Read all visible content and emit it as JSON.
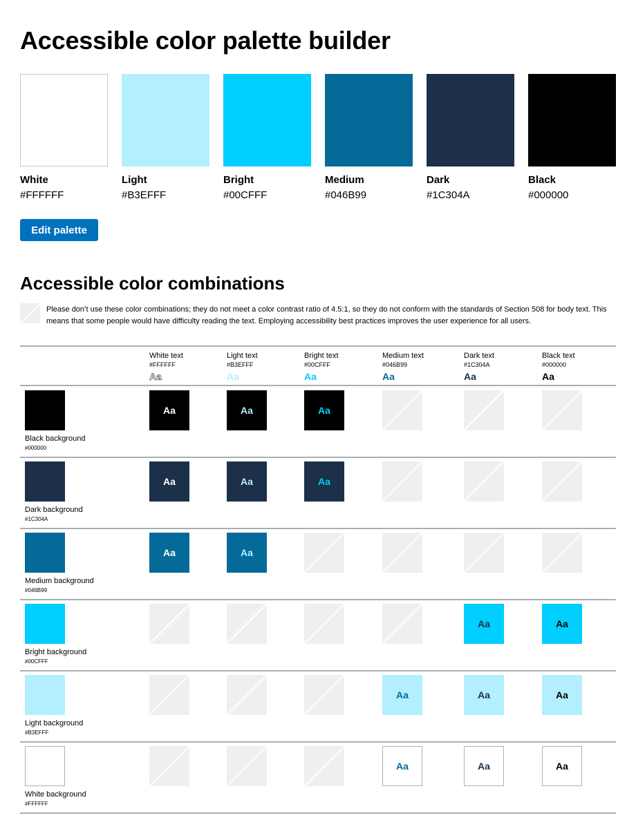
{
  "page": {
    "title": "Accessible color palette builder",
    "edit_button": "Edit palette",
    "combinations_title": "Accessible color combinations",
    "warning": "Please don’t use these color combinations; they do not meet a color contrast ratio of 4.5:1, so they do not conform with the standards of Section 508 for body text. This means that some people would have difficulty reading the text. Employing accessibility best practices improves the user experience for all users."
  },
  "palette": [
    {
      "name": "White",
      "hex": "#FFFFFF"
    },
    {
      "name": "Light",
      "hex": "#B3EFFF"
    },
    {
      "name": "Bright",
      "hex": "#00CFFF"
    },
    {
      "name": "Medium",
      "hex": "#046B99"
    },
    {
      "name": "Dark",
      "hex": "#1C304A"
    },
    {
      "name": "Black",
      "hex": "#000000"
    }
  ],
  "columns": [
    {
      "label": "White text",
      "hex": "#FFFFFF",
      "sample": "Aa",
      "color": "#FFFFFF"
    },
    {
      "label": "Light text",
      "hex": "#B3EFFF",
      "sample": "Aa",
      "color": "#B3EFFF"
    },
    {
      "label": "Bright text",
      "hex": "#00CFFF",
      "sample": "Aa",
      "color": "#00CFFF"
    },
    {
      "label": "Medium text",
      "hex": "#046B99",
      "sample": "Aa",
      "color": "#046B99"
    },
    {
      "label": "Dark text",
      "hex": "#1C304A",
      "sample": "Aa",
      "color": "#1C304A"
    },
    {
      "label": "Black text",
      "hex": "#000000",
      "sample": "Aa",
      "color": "#000000"
    }
  ],
  "rows": [
    {
      "label": "Black background",
      "hex": "#000000",
      "color": "#000000",
      "cells": [
        "Aa",
        "Aa",
        "Aa",
        "",
        "",
        ""
      ]
    },
    {
      "label": "Dark background",
      "hex": "#1C304A",
      "color": "#1C304A",
      "cells": [
        "Aa",
        "Aa",
        "Aa",
        "",
        "",
        ""
      ]
    },
    {
      "label": "Medium background",
      "hex": "#046B99",
      "color": "#046B99",
      "cells": [
        "Aa",
        "Aa",
        "",
        "",
        "",
        ""
      ]
    },
    {
      "label": "Bright background",
      "hex": "#00CFFF",
      "color": "#00CFFF",
      "cells": [
        "",
        "",
        "",
        "",
        "Aa",
        "Aa"
      ]
    },
    {
      "label": "Light background",
      "hex": "#B3EFFF",
      "color": "#B3EFFF",
      "cells": [
        "",
        "",
        "",
        "Aa",
        "Aa",
        "Aa"
      ]
    },
    {
      "label": "White background",
      "hex": "#FFFFFF",
      "color": "#FFFFFF",
      "cells": [
        "",
        "",
        "",
        "Aa",
        "Aa",
        "Aa"
      ]
    }
  ],
  "colors": {
    "button": "#0071BC",
    "unavailable": "#EFEFEF",
    "rule": "#A9AEB1"
  }
}
